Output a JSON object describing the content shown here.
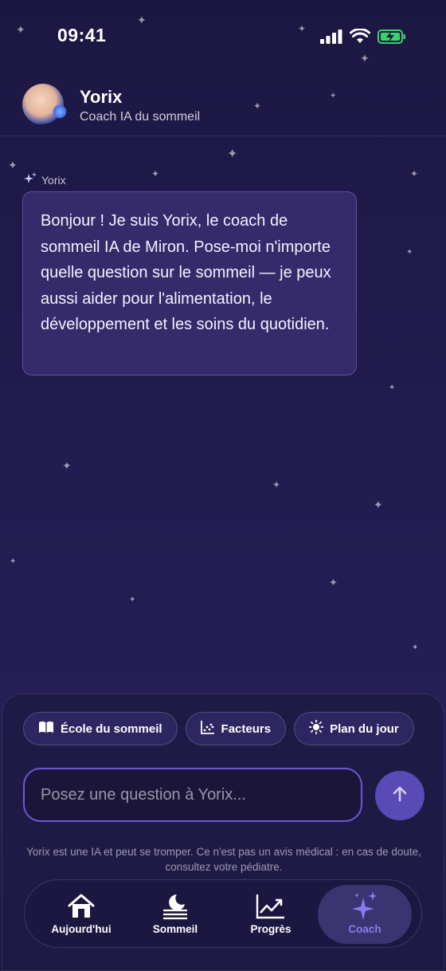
{
  "status_bar": {
    "time": "09:41"
  },
  "header": {
    "name": "Yorix",
    "subtitle": "Coach IA du sommeil"
  },
  "message": {
    "sender": "Yorix",
    "text": "Bonjour ! Je suis Yorix, le coach de sommeil IA de Miron. Pose-moi n'importe quelle question sur le sommeil — je peux aussi aider pour l'alimentation, le développement et les soins du quotidien."
  },
  "chips": [
    {
      "label": "École du sommeil",
      "icon": "book-icon"
    },
    {
      "label": "Facteurs",
      "icon": "scatter-chart-icon"
    },
    {
      "label": "Plan du jour",
      "icon": "sun-icon"
    }
  ],
  "composer": {
    "placeholder": "Posez une question à Yorix...",
    "disclaimer": "Yorix est une IA et peut se tromper. Ce n'est pas un avis médical : en cas de doute, consultez votre pédiatre."
  },
  "tabs": [
    {
      "label": "Aujourd'hui",
      "icon": "home-icon"
    },
    {
      "label": "Sommeil",
      "icon": "moon-icon"
    },
    {
      "label": "Progrès",
      "icon": "trend-chart-icon"
    },
    {
      "label": "Coach",
      "icon": "sparkles-icon",
      "active": true
    }
  ],
  "colors": {
    "accent": "#8b7af0",
    "bubble": "#352b6a",
    "send": "#5a4ab6"
  }
}
